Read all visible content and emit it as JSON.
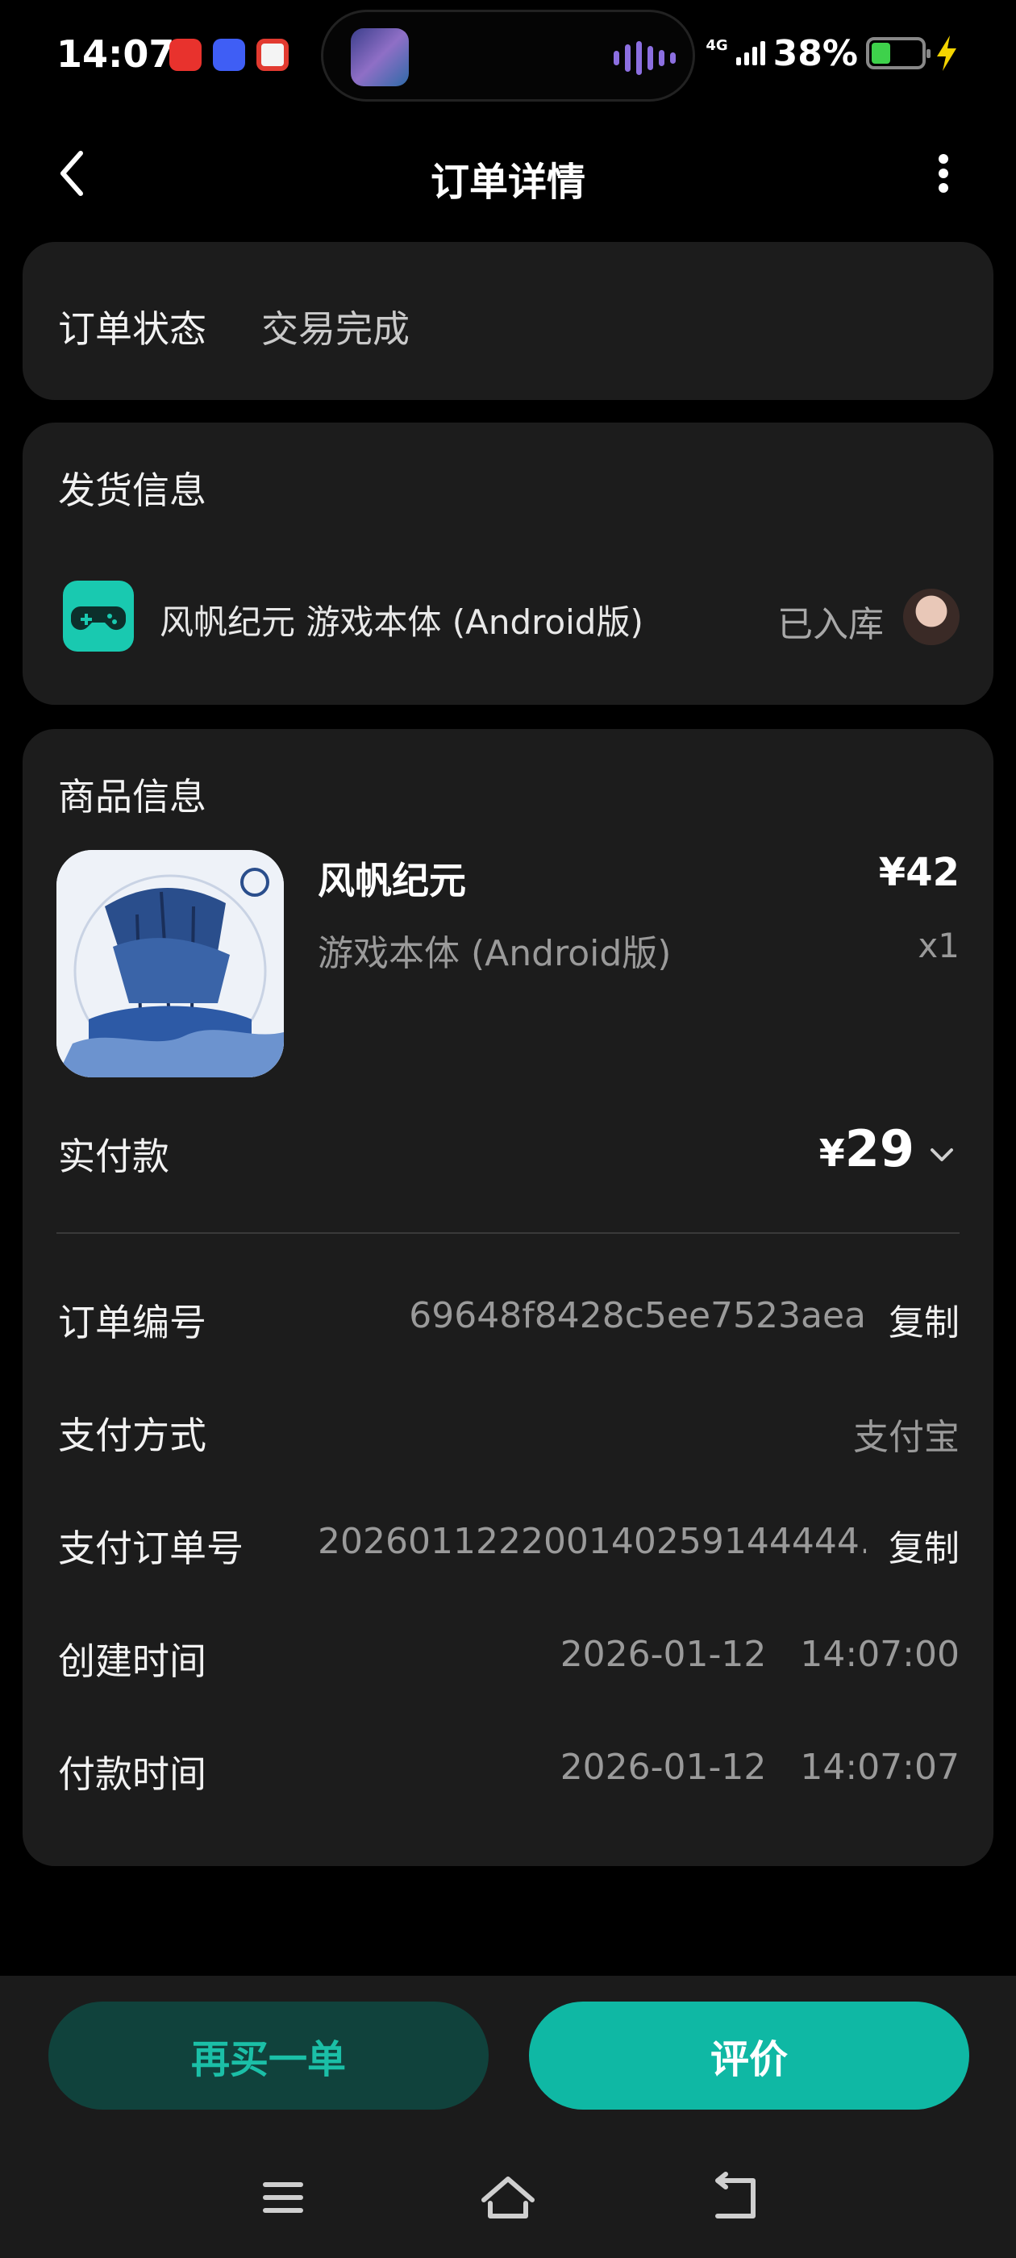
{
  "status_bar": {
    "time": "14:07",
    "network": "4G",
    "battery": "38%",
    "battery_level": 0.38
  },
  "header": {
    "title": "订单详情"
  },
  "order_status": {
    "label": "订单状态",
    "value": "交易完成"
  },
  "shipping": {
    "title": "发货信息",
    "item_name": "风帆纪元 游戏本体 (Android版)",
    "state": "已入库"
  },
  "goods": {
    "title": "商品信息",
    "name": "风帆纪元",
    "spec": "游戏本体 (Android版)",
    "price": "¥42",
    "qty": "x1",
    "paid_label": "实付款",
    "paid_currency": "¥",
    "paid_amount": "29"
  },
  "details": {
    "order_no_label": "订单编号",
    "order_no": "69648f8428c5ee7523aea",
    "pay_method_label": "支付方式",
    "pay_method": "支付宝",
    "pay_no_label": "支付订单号",
    "pay_no": "202601122200140259144444…",
    "created_label": "创建时间",
    "created_date": "2026-01-12",
    "created_time": "14:07:00",
    "paid_time_label": "付款时间",
    "paid_date": "2026-01-12",
    "paid_time": "14:07:07",
    "copy_label": "复制"
  },
  "actions": {
    "rebuy": "再买一单",
    "review": "评价"
  },
  "colors": {
    "accent": "#0fb8a4",
    "card": "#1c1c1c",
    "background": "#000000"
  }
}
